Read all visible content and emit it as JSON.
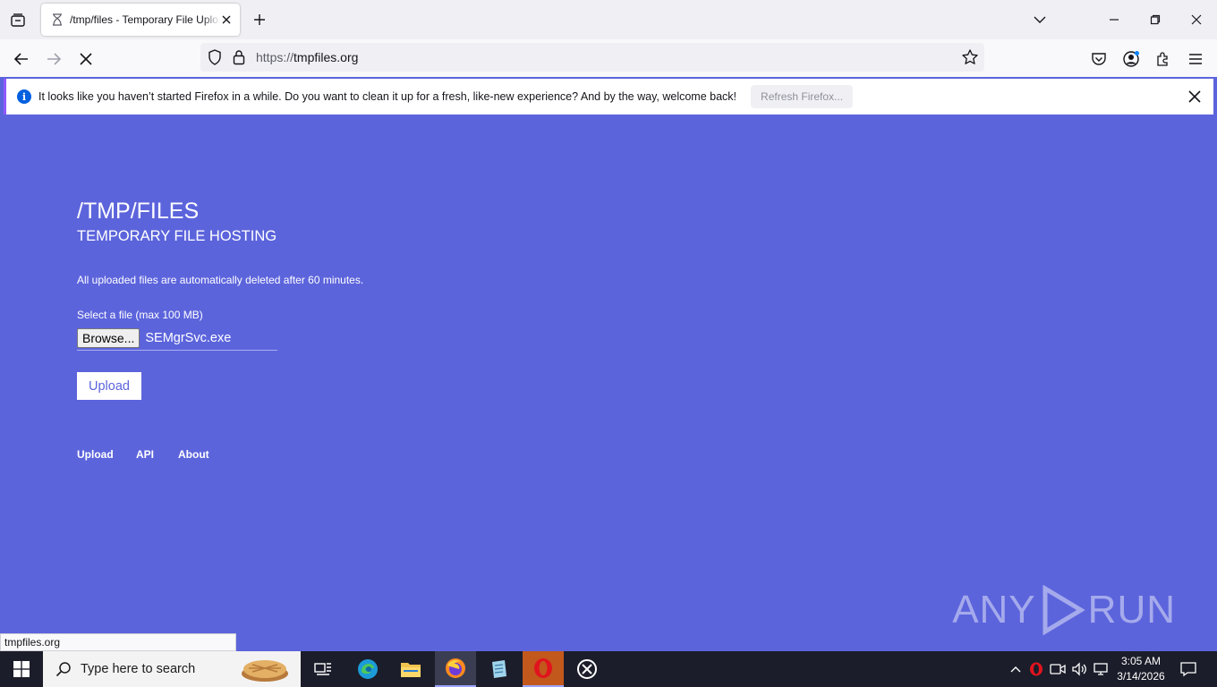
{
  "browser": {
    "tab_title": "/tmp/files - Temporary File Upload",
    "url_scheme": "https://",
    "url_host": "tmpfiles.org",
    "notification": "It looks like you haven’t started Firefox in a while. Do you want to clean it up for a fresh, like-new experience? And by the way, welcome back!",
    "notification_button": "Refresh Firefox...",
    "status_url": "tmpfiles.org",
    "accent": "#9059ff"
  },
  "page": {
    "title": "/TMP/FILES",
    "subtitle": "TEMPORARY FILE HOSTING",
    "notice": "All uploaded files are automatically deleted after 60 minutes.",
    "select_label": "Select a file (max 100 MB)",
    "browse_label": "Browse...",
    "file_name": "SEMgrSvc.exe",
    "upload_label": "Upload",
    "footer_links": [
      "Upload",
      "API",
      "About"
    ],
    "background": "#5c64dc",
    "watermark_left": "ANY",
    "watermark_right": "RUN"
  },
  "taskbar": {
    "search_placeholder": "Type here to search",
    "time": "3:05 AM",
    "date": "3/14/2026"
  }
}
